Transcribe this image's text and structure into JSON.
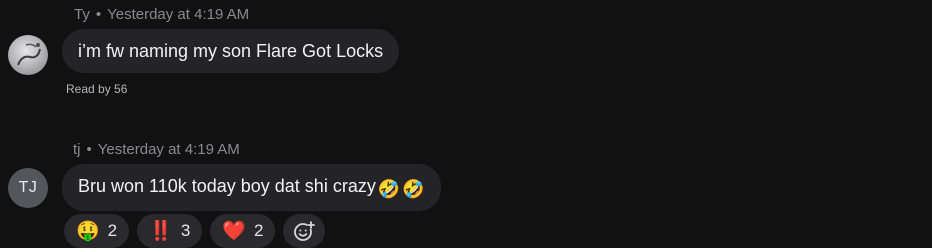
{
  "messages": [
    {
      "author": "Ty",
      "separator": "•",
      "timestamp": "Yesterday at 4:19 AM",
      "text": "i’m fw naming my son Flare Got Locks",
      "read_by": "Read by 56"
    },
    {
      "author": "tj",
      "separator": "•",
      "timestamp": "Yesterday at 4:19 AM",
      "avatar_initials": "TJ",
      "text": "Bru won 110k today boy dat shi crazy",
      "text_emojis": [
        "🤣",
        "🤣"
      ],
      "reactions": [
        {
          "emoji": "🤑",
          "count": "2",
          "icon": "money-mouth-face-icon"
        },
        {
          "emoji": "‼️",
          "count": "3",
          "icon": "double-exclamation-icon"
        },
        {
          "emoji": "❤️",
          "count": "2",
          "icon": "heart-icon"
        }
      ]
    }
  ],
  "colors": {
    "background": "#111112",
    "bubble": "#242426",
    "meta_text": "#8a8a8e",
    "reaction_pill": "#2a2a2c"
  }
}
